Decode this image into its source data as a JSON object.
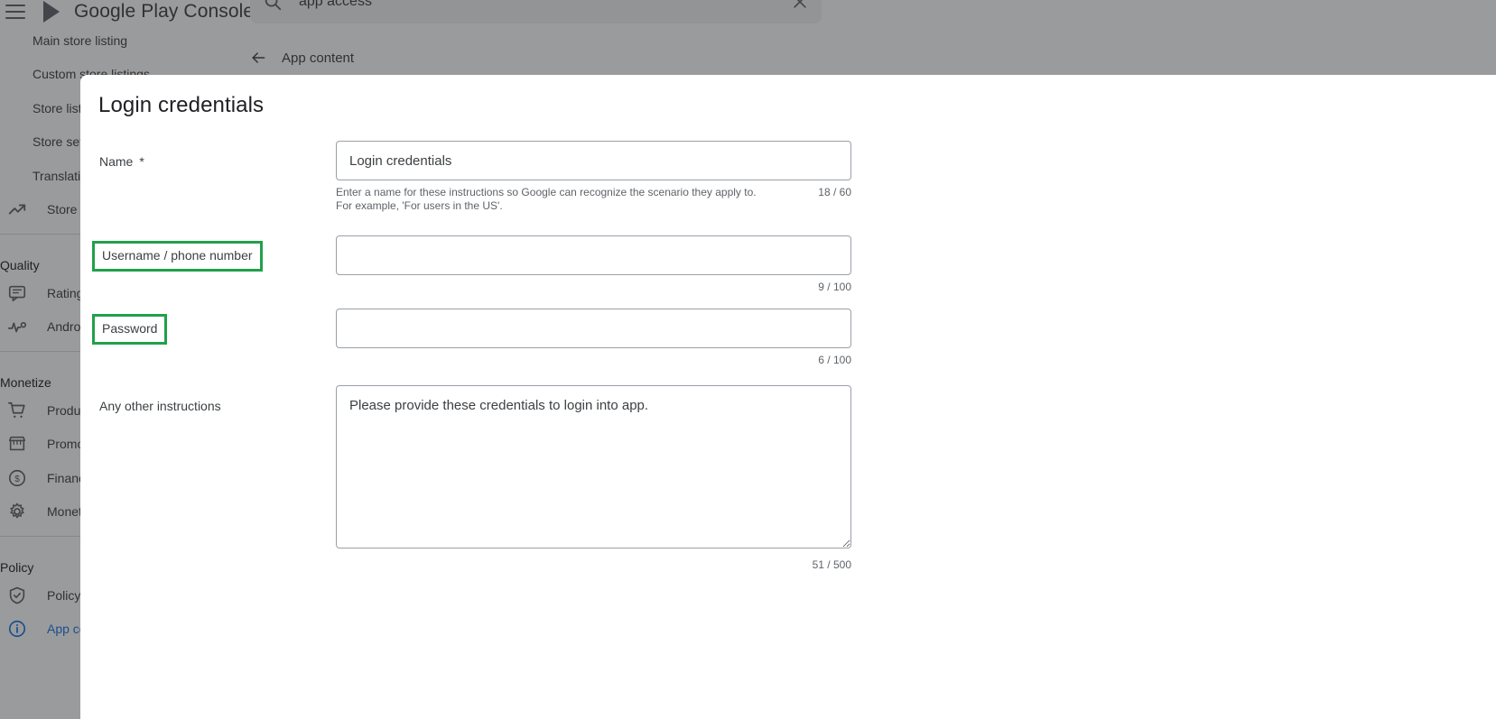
{
  "appbar": {
    "menu_icon": "hamburger-menu-icon",
    "brand": "Google Play Console",
    "search_icon": "search-icon",
    "search_value": "app access",
    "close_icon": "close-icon"
  },
  "sidebar": {
    "items": [
      {
        "label": "Main store listing",
        "icon": null,
        "type": "item"
      },
      {
        "label": "Custom store listings",
        "icon": null,
        "type": "item"
      },
      {
        "label": "Store listing experiments",
        "icon": null,
        "type": "item"
      },
      {
        "label": "Store settings",
        "icon": null,
        "type": "item"
      },
      {
        "label": "Translation service",
        "icon": null,
        "type": "item"
      },
      {
        "label": "Store performance",
        "icon": "trending-up-icon",
        "type": "item"
      }
    ],
    "sections": [
      {
        "title": "Quality",
        "items": [
          {
            "label": "Ratings and reviews",
            "icon": "review-icon"
          },
          {
            "label": "Android vitals",
            "icon": "vitals-pulse-icon"
          }
        ]
      },
      {
        "title": "Monetize",
        "items": [
          {
            "label": "Products",
            "icon": "shopping-cart-icon"
          },
          {
            "label": "Promo content",
            "icon": "storefront-icon"
          },
          {
            "label": "Financial reports",
            "icon": "dollar-circle-icon"
          },
          {
            "label": "Monetization setup",
            "icon": "gear-icon"
          }
        ]
      },
      {
        "title": "Policy",
        "items": [
          {
            "label": "Policy status",
            "icon": "shield-check-icon"
          },
          {
            "label": "App content",
            "icon": "info-circle-icon"
          }
        ]
      }
    ]
  },
  "content": {
    "back_icon": "arrow-left-icon",
    "back_label": "App content"
  },
  "dialog": {
    "title": "Login credentials",
    "fields": [
      {
        "id": "name",
        "label": "Name",
        "required_marker": "*",
        "value": "Login credentials",
        "placeholder": "",
        "helper": "Enter a name for these instructions so Google can recognize the scenario they apply to. For example, 'For users in the US'.",
        "counter": "18 / 60",
        "highlighted": false
      },
      {
        "id": "username",
        "label": "Username / phone number",
        "required_marker": "",
        "value": "",
        "placeholder": "",
        "helper": "",
        "counter": "9 / 100",
        "highlighted": true
      },
      {
        "id": "password",
        "label": "Password",
        "required_marker": "",
        "value": "",
        "placeholder": "",
        "helper": "",
        "counter": "6 / 100",
        "highlighted": true
      },
      {
        "id": "instructions",
        "label": "Any other instructions",
        "required_marker": "",
        "value": "Please provide these credentials to login into app.",
        "placeholder": "",
        "helper": "",
        "counter": "51 / 500",
        "highlighted": false
      }
    ]
  },
  "colors": {
    "highlight": "#21a04a",
    "accent": "#1a73e8",
    "text_primary": "#202124",
    "text_secondary": "#5f6368",
    "border": "#9aa0a6",
    "scrim": "rgba(32,33,36,0.45)"
  }
}
